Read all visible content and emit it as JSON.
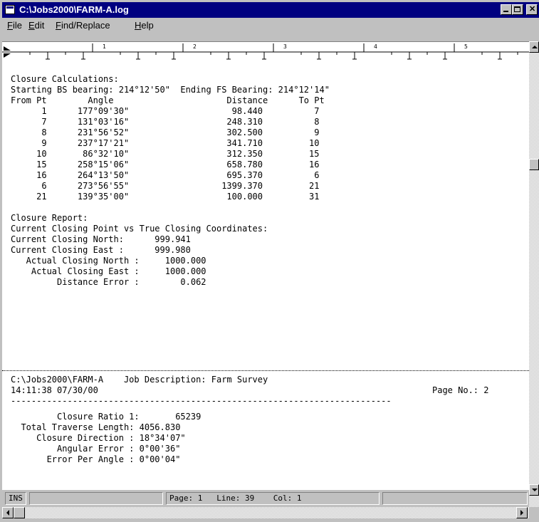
{
  "window": {
    "title": "C:\\Jobs2000\\FARM-A.log"
  },
  "menu": [
    {
      "pre": "",
      "u": "F",
      "post": "ile"
    },
    {
      "pre": "",
      "u": "E",
      "post": "dit"
    },
    {
      "pre": "",
      "u": "F",
      "post": "ind/Replace"
    },
    {
      "pre": "",
      "u": "H",
      "post": "elp"
    }
  ],
  "ruler": {
    "numbers": [
      "1",
      "2",
      "3",
      "4",
      "5"
    ]
  },
  "document": {
    "section1": "Closure Calculations:\nStarting BS bearing: 214°12'50\"  Ending FS Bearing: 214°12'14\"\nFrom Pt        Angle                      Distance      To Pt\n      1      177°09'30\"                    98.440          7\n      7      131°03'16\"                   248.310          8\n      8      231°56'52\"                   302.500          9\n      9      237°17'21\"                   341.710         10\n     10       86°32'10\"                   312.350         15\n     15      258°15'06\"                   658.780         16\n     16      264°13'50\"                   695.370          6\n      6      273°56'55\"                  1399.370         21\n     21      139°35'00\"                   100.000         31\n\nClosure Report:\nCurrent Closing Point vs True Closing Coordinates:\nCurrent Closing North:      999.941\nCurrent Closing East :      999.980\n   Actual Closing North :     1000.000\n    Actual Closing East :     1000.000\n         Distance Error :        0.062",
    "page_header_left": "C:\\Jobs2000\\FARM-A    Job Description: Farm Survey\n14:11:38 07/30/00",
    "page_number": "Page No.: 2",
    "separator": "--------------------------------------------------------------------------",
    "section2": "         Closure Ratio 1:       65239\n  Total Traverse Length: 4056.830\n     Closure Direction : 18°34'07\"\n         Angular Error : 0°00'36\"\n       Error Per Angle : 0°00'04\""
  },
  "status": {
    "mode": "INS",
    "page": "Page: 1",
    "line": "Line: 39",
    "col": "Col: 1"
  }
}
